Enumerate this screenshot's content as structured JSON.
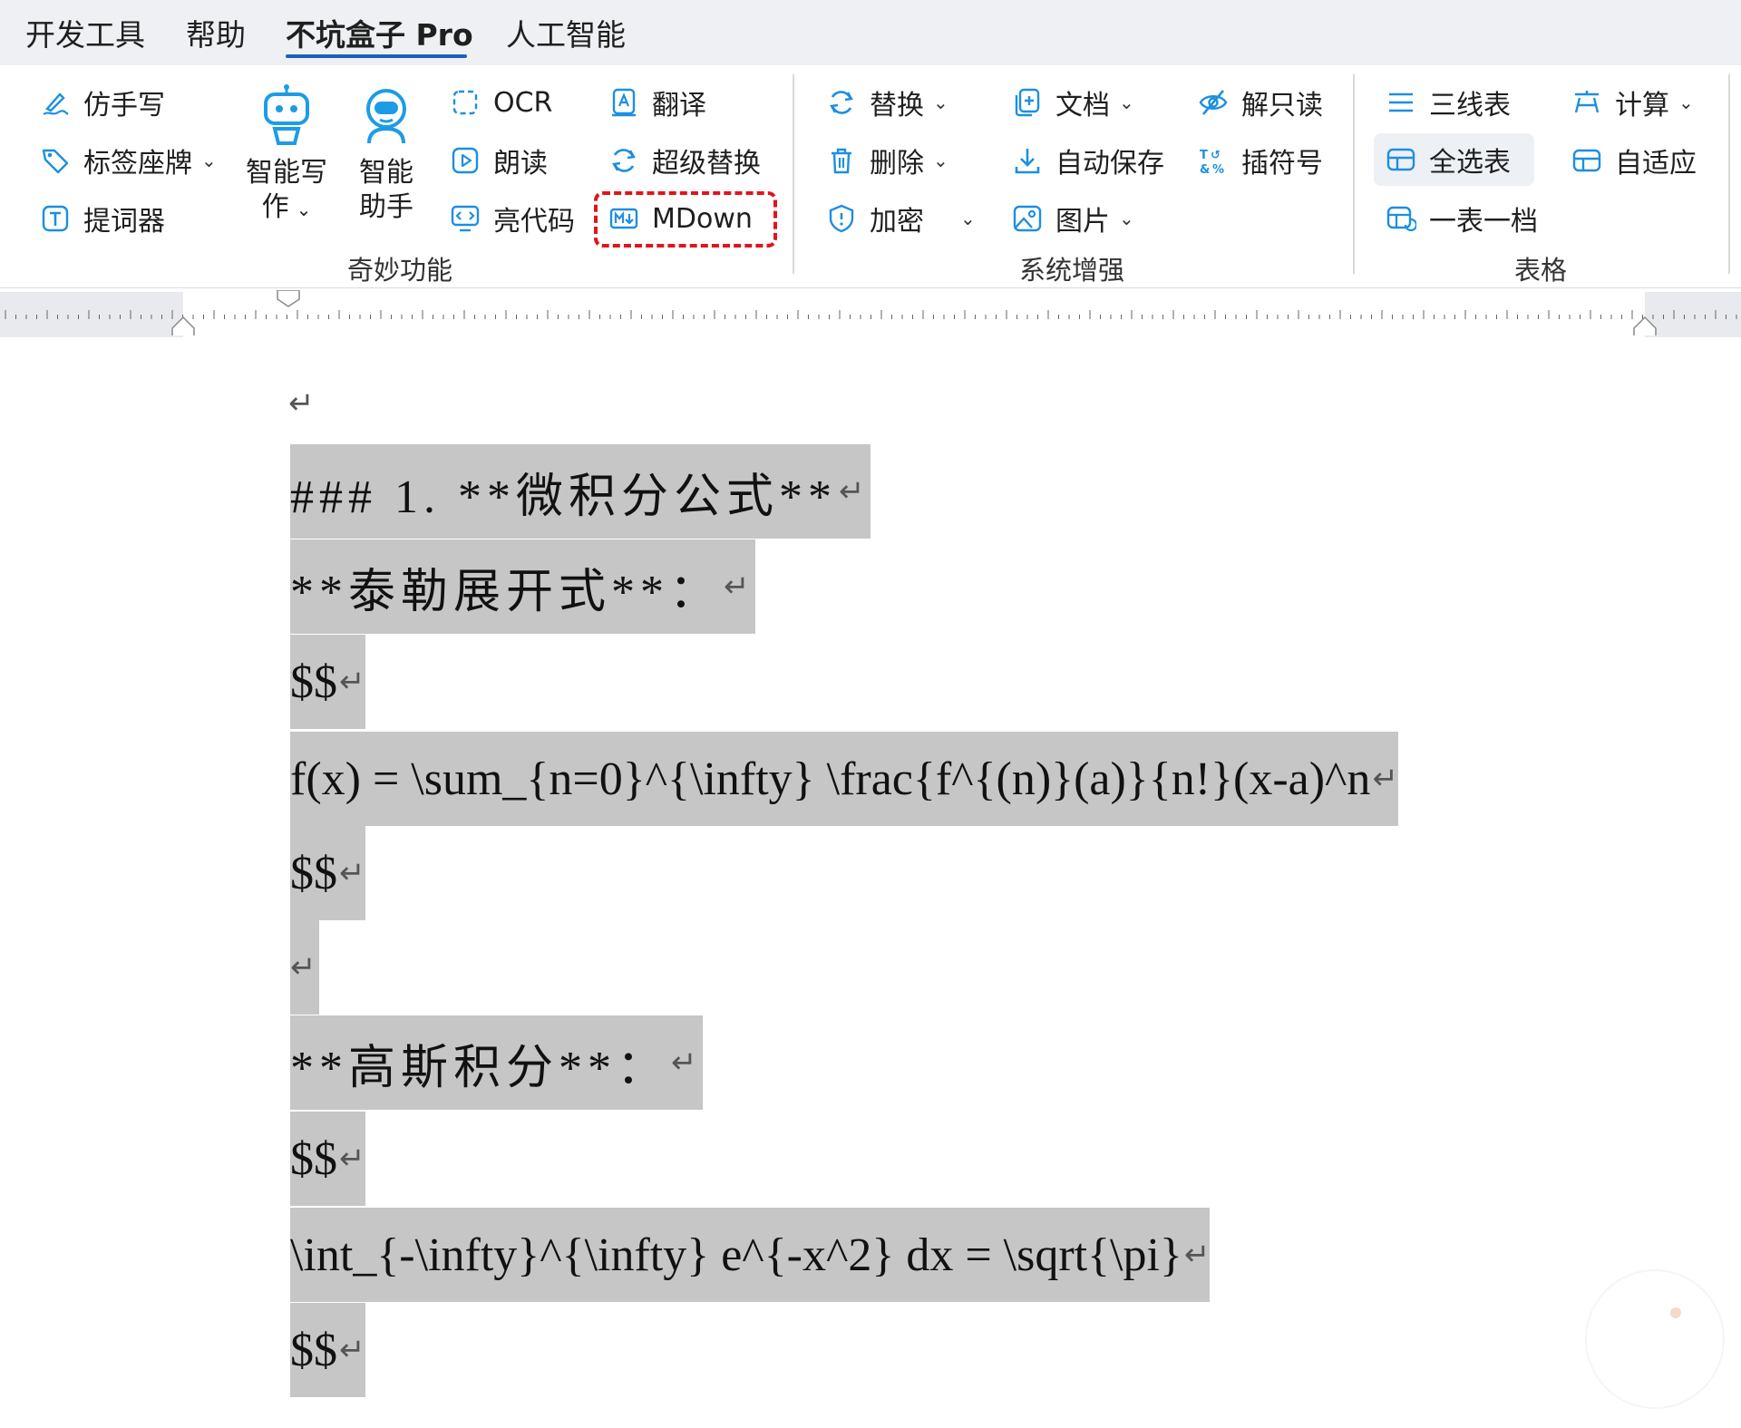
{
  "menu": {
    "tabs": [
      {
        "label": "开发工具"
      },
      {
        "label": "帮助"
      },
      {
        "label": "不坑盒子 Pro",
        "active": true
      },
      {
        "label": "人工智能"
      }
    ]
  },
  "ribbon": {
    "groups": {
      "wonder": {
        "label": "奇妙功能",
        "items": {
          "imitate_handwriting": "仿手写",
          "label_nameplate": "标签座牌",
          "teleprompter": "提词器",
          "smart_writing_l1": "智能写",
          "smart_writing_l2": "作",
          "smart_assistant_l1": "智能",
          "smart_assistant_l2": "助手",
          "ocr": "OCR",
          "read_aloud": "朗读",
          "highlight_code": "亮代码",
          "translate": "翻译",
          "super_replace": "超级替换",
          "mdown": "MDown"
        }
      },
      "system": {
        "label": "系统增强",
        "items": {
          "replace": "替换",
          "delete": "删除",
          "encrypt": "加密",
          "document": "文档",
          "autosave": "自动保存",
          "image": "图片",
          "unlock_readonly": "解只读",
          "insert_symbol": "插符号"
        }
      },
      "table": {
        "label": "表格",
        "items": {
          "three_line": "三线表",
          "select_all_tables": "全选表",
          "one_table_per_file": "一表一档",
          "calculate": "计算",
          "autofit": "自适应"
        }
      }
    },
    "accent_color": "#1d8fe0",
    "highlight_frame_color": "#e0141e"
  },
  "document": {
    "pilcrow": "↵",
    "lines": [
      {
        "text": "",
        "selected": false
      },
      {
        "text": "### 1. **微积分公式**",
        "selected": true
      },
      {
        "text": "**泰勒展开式**：",
        "selected": true
      },
      {
        "text": "$$",
        "selected": true
      },
      {
        "text": "f(x) = \\sum_{n=0}^{\\infty} \\frac{f^{(n)}(a)}{n!}(x-a)^n",
        "selected": true
      },
      {
        "text": "$$",
        "selected": true
      },
      {
        "text": "",
        "selected": true
      },
      {
        "text": "**高斯积分**：",
        "selected": true
      },
      {
        "text": "$$",
        "selected": true
      },
      {
        "text": "\\int_{-\\infty}^{\\infty} e^{-x^2} dx = \\sqrt{\\pi}",
        "selected": true
      },
      {
        "text": "$$",
        "selected": true
      }
    ]
  }
}
